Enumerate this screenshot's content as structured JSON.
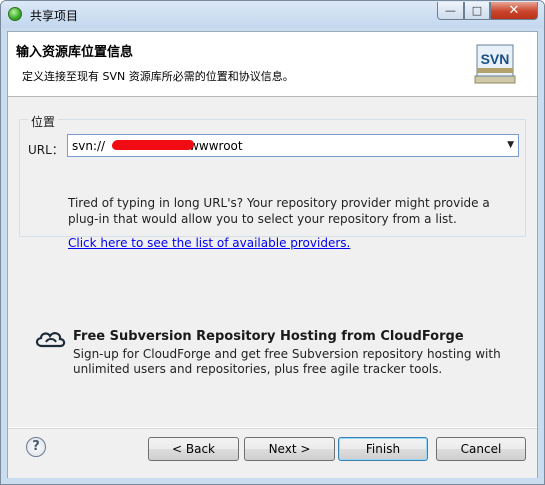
{
  "window": {
    "title": "共享项目",
    "min_label": "—",
    "max_label": "□",
    "close_label": "✕"
  },
  "header": {
    "title": "输入资源库位置信息",
    "description": "定义连接至现有 SVN 资源库所必需的位置和协议信息。",
    "logo_text": "SVN"
  },
  "location": {
    "group_label": "位置",
    "url_label": "URL：",
    "url_prefix": "svn://",
    "url_suffix": "wwwroot",
    "hint": "Tired of typing in long URL's?  Your repository provider might provide a plug-in that would allow you to select your repository from a list.",
    "providers_link": "Click here to see the list of available providers."
  },
  "cloudforge": {
    "title": "Free Subversion Repository Hosting from CloudForge",
    "description": "Sign-up for CloudForge and get free Subversion repository hosting with unlimited users and repositories, plus free agile tracker tools."
  },
  "buttons": {
    "help": "?",
    "back": "< Back",
    "next": "Next >",
    "finish": "Finish",
    "cancel": "Cancel"
  },
  "colors": {
    "link": "#0000ee",
    "redaction": "#f00c12",
    "accent": "#3c7fb1"
  }
}
